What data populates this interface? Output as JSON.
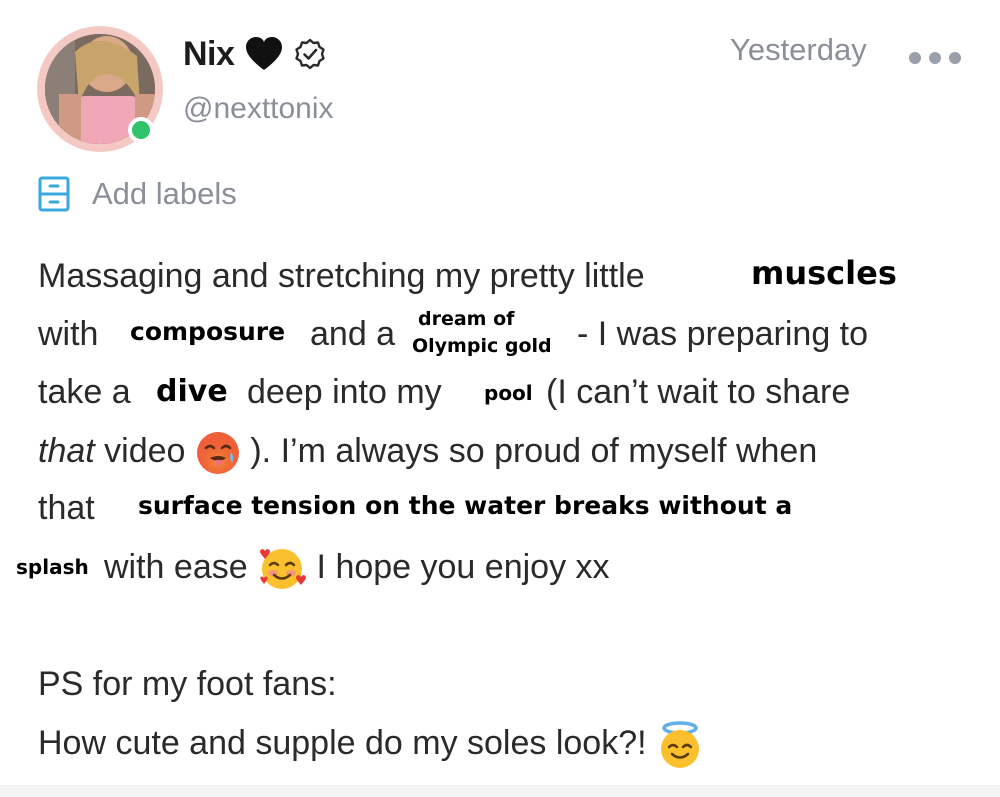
{
  "author": {
    "display_name": "Nix",
    "handle": "@nexttonix",
    "online": true
  },
  "timestamp": "Yesterday",
  "labels_text": "Add labels",
  "colors": {
    "muted_text": "#8a8f99",
    "accent": "#3aa9e0",
    "online": "#2fc46b",
    "avatar_ring": "#f4c9c3"
  },
  "icons": {
    "heart": "black-heart-icon",
    "verified": "verified-badge-icon",
    "more": "more-dots-icon",
    "labels": "label-drawer-icon"
  },
  "body": {
    "line1": "Massaging and stretching my pretty little",
    "line1_overlay": "muscles",
    "line2_a": "with",
    "line2_overlay_a": "composure",
    "line2_b": "and a",
    "line2_overlay_b1": "dream of",
    "line2_overlay_b2": "Olympic gold",
    "line2_c": "- I was preparing to",
    "line3_a": "take a",
    "line3_overlay_a": "dive",
    "line3_b": "deep into my",
    "line3_overlay_b": "pool",
    "line3_c": "(I can’t wait to share",
    "line4_italic": "that",
    "line4_a": "video",
    "line4_b": "). I’m always so proud of myself when",
    "line5_a": "that",
    "line5_overlay": "surface tension on the water breaks without a",
    "line6_overlay": "splash",
    "line6_a": "with ease",
    "line6_b": "I hope you enjoy xx",
    "ps_line1": "PS for my foot fans:",
    "ps_line2": "How cute and supple do my soles look?!"
  }
}
